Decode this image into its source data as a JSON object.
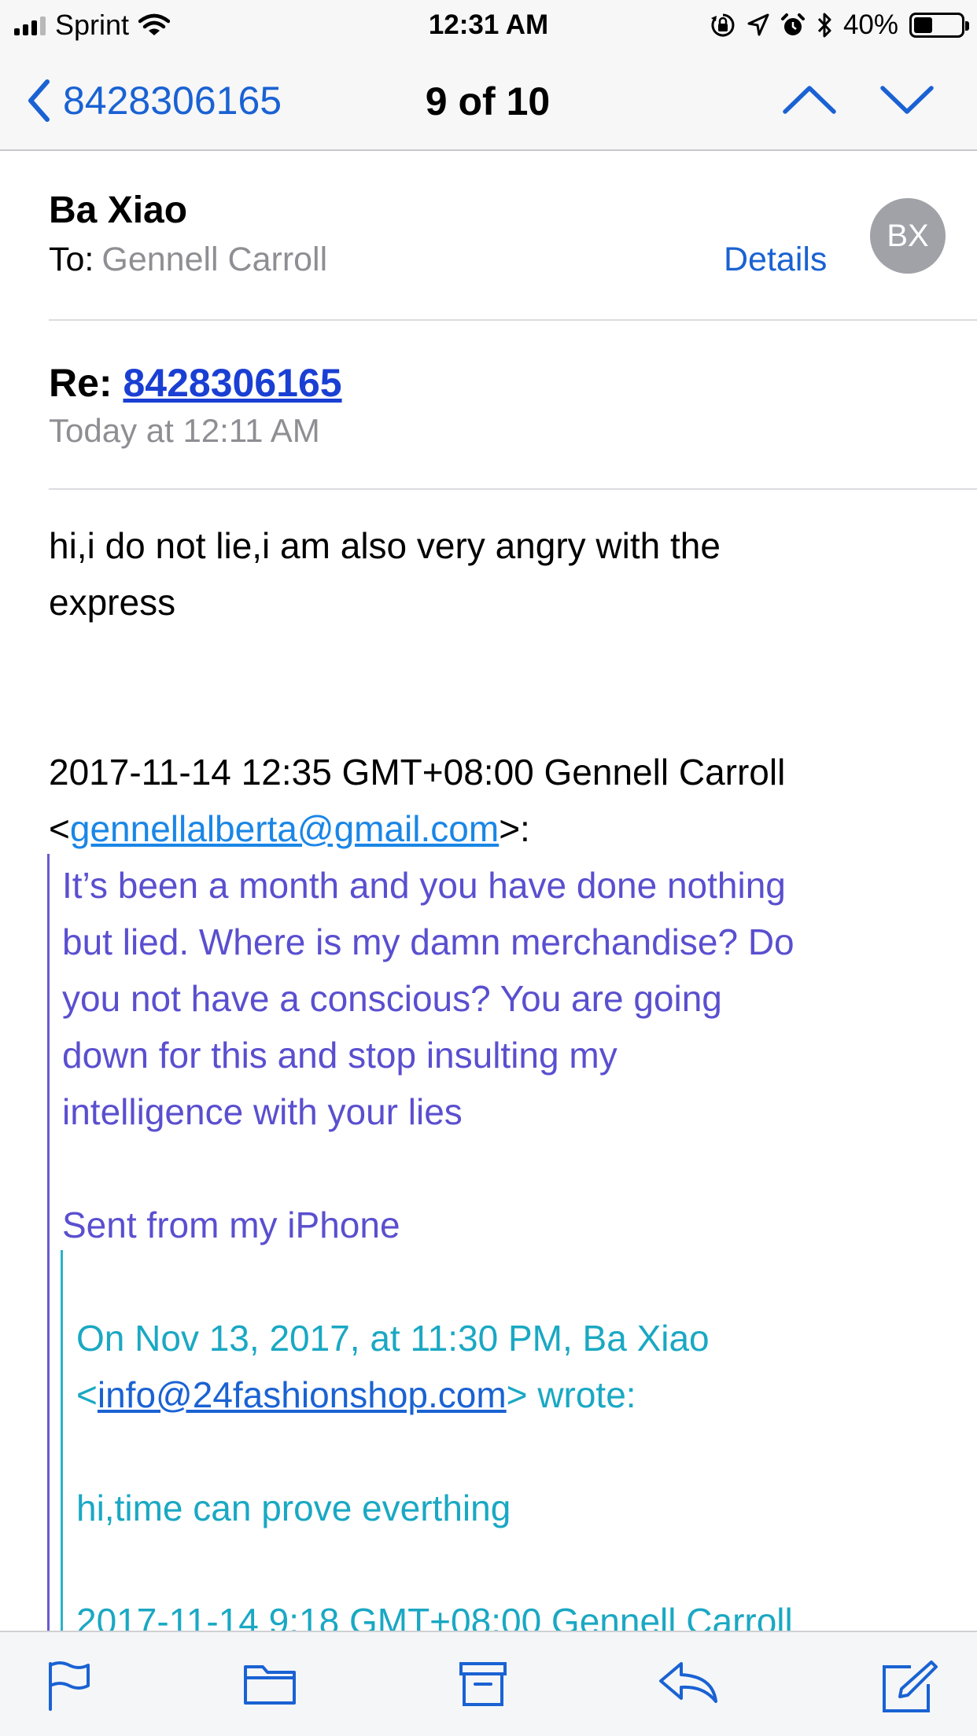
{
  "status_bar": {
    "carrier": "Sprint",
    "time": "12:31 AM",
    "battery_percent": "40%",
    "battery_level": 0.4,
    "icons": [
      "signal-icon",
      "wifi-icon",
      "orientation-lock-icon",
      "location-icon",
      "alarm-icon",
      "bluetooth-icon",
      "battery-icon"
    ]
  },
  "nav": {
    "back_label": "8428306165",
    "position": "9 of 10",
    "icons": [
      "chevron-left-icon",
      "chevron-up-icon",
      "chevron-down-icon"
    ]
  },
  "header": {
    "sender": "Ba Xiao",
    "to_label": "To:",
    "to_name": "Gennell Carroll",
    "details_label": "Details",
    "avatar_initials": "BX"
  },
  "subject": {
    "prefix": "Re:",
    "number": "8428306165",
    "date": "Today at 12:11 AM"
  },
  "body": {
    "line1": "hi,i do not lie,i am also very angry with the",
    "line2": "express",
    "quote_header_1": "2017-11-14 12:35 GMT+08:00 Gennell Carroll",
    "quote_header_2_open": "<",
    "quote_email": "gennellalberta@gmail.com",
    "quote_header_2_close": ">:",
    "q1_lines": [
      "It’s been a month and you have done nothing",
      "but lied. Where is my damn merchandise? Do",
      "you not have a conscious? You are going",
      "down for this and stop insulting my",
      "intelligence with your lies"
    ],
    "q1_signature": "Sent from my iPhone",
    "q2_header_1": "On Nov 13, 2017, at 11:30 PM, Ba Xiao",
    "q2_header_2_open": "<",
    "q2_email": "info@24fashionshop.com",
    "q2_header_2_close": "> wrote:",
    "q2_text": "hi,time can prove everthing",
    "q2_partial": "2017-11-14 9:18 GMT+08:00 Gennell Carroll"
  },
  "toolbar": {
    "icons": [
      "flag-icon",
      "folder-icon",
      "archive-icon",
      "reply-icon",
      "compose-icon"
    ]
  },
  "colors": {
    "accent": "#1a62d3",
    "quote_level_1": "#5a4fcf",
    "quote_level_2": "#1aa8c3"
  }
}
